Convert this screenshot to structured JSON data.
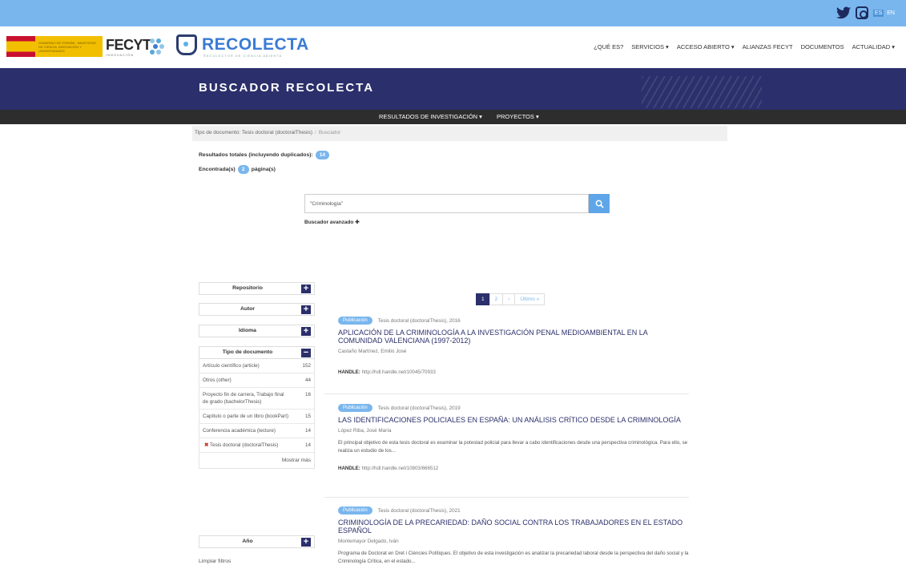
{
  "lang": {
    "es": "ES",
    "en": "EN"
  },
  "header": {
    "gov_text": "GOBIERNO DE ESPAÑA · MINISTERIO DE CIENCIA, INNOVACIÓN Y UNIVERSIDADES",
    "fecyt": "FECYT",
    "fecyt_sub": "INNOVACIÓN",
    "recolecta": "RECOLECTA",
    "recolecta_sub": "RECOLECTOR DE CIENCIA ABIERTA"
  },
  "nav": [
    "¿QUÉ ES?",
    "SERVICIOS ▾",
    "ACCESO ABIERTO ▾",
    "ALIANZAS FECYT",
    "DOCUMENTOS",
    "ACTUALIDAD ▾"
  ],
  "hero": {
    "title": "BUSCADOR RECOLECTA"
  },
  "subnav": [
    "RESULTADOS DE INVESTIGACIÓN ▾",
    "PROYECTOS ▾"
  ],
  "breadcrumb": {
    "filter": "Tipo de documento: Tesis doctoral (doctoralThesis)",
    "current": "Buscador"
  },
  "totals": {
    "label": "Resultados totales (incluyendo duplicados):",
    "count": "14"
  },
  "pages": {
    "prefix": "Encontrada(s)",
    "count": "2",
    "suffix": "página(s)"
  },
  "search": {
    "value": "\"Criminología\"",
    "advanced": "Buscador avanzado"
  },
  "facets": {
    "repositorio": "Repositorio",
    "autor": "Autor",
    "idioma": "Idioma",
    "tipo": "Tipo de documento",
    "anio": "Año",
    "tipo_items": [
      {
        "label": "Artículo científico (article)",
        "count": "152"
      },
      {
        "label": "Otros (other)",
        "count": "44"
      },
      {
        "label": "Proyecto fin de carrera, Trabajo final de grado (bachelorThesis)",
        "count": "16"
      },
      {
        "label": "Capítulo o parte de un libro (bookPart)",
        "count": "15"
      },
      {
        "label": "Conferencia académica (lecture)",
        "count": "14"
      },
      {
        "label": "Tesis doctoral (doctoralThesis)",
        "count": "14"
      }
    ],
    "more": "Mostrar más",
    "clear": "Limpiar filtros"
  },
  "pager": {
    "p1": "1",
    "p2": "2",
    "next": "›",
    "last": "Último »"
  },
  "results": [
    {
      "badge": "Publicación",
      "meta": "Tesis doctoral (doctoralThesis), 2016",
      "title": "APLICACIÓN DE LA CRIMINOLOGÍA A LA INVESTIGACIÓN PENAL MEDIOAMBIENTAL EN LA COMUNIDAD VALENCIANA (1997-2012)",
      "author": "Castaño Martínez, Emilio José",
      "abstract": "",
      "handle_label": "HANDLE:",
      "handle": "http://hdl.handle.net/10045/70933"
    },
    {
      "badge": "Publicación",
      "meta": "Tesis doctoral (doctoralThesis), 2019",
      "title": "LAS IDENTIFICACIONES POLICIALES EN ESPAÑA: UN ANÁLISIS CRÍTICO DESDE LA CRIMINOLOGÍA",
      "author": "López Riba, José María",
      "abstract": "El principal objetivo de esta tesis doctoral es examinar la potestad policial para llevar a cabo identificaciones desde una perspectiva criminológica. Para ello, se realiza un estudio de los...",
      "handle_label": "HANDLE:",
      "handle": "http://hdl.handle.net/10803/666512"
    },
    {
      "badge": "Publicación",
      "meta": "Tesis doctoral (doctoralThesis), 2021",
      "title": "CRIMINOLOGÍA DE LA PRECARIEDAD: DAÑO SOCIAL CONTRA LOS TRABAJADORES EN EL ESTADO ESPAÑOL",
      "author": "Montemayor Delgado, Iván",
      "abstract": "Programa de Doctorat en Dret i Ciències Polítiques. El objetivo de esta investigación es analizar la precariedad laboral desde la perspectiva del daño social y la Criminología Crítica, en el estado...",
      "handle_label": "",
      "handle": ""
    }
  ]
}
